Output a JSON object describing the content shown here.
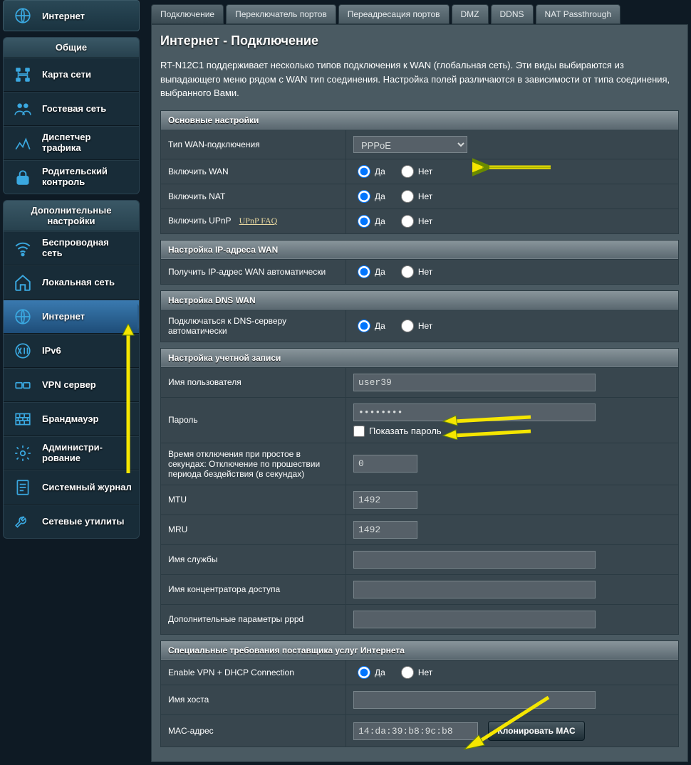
{
  "topItem": "Интернет",
  "sidebar": {
    "general_header": "Общие",
    "general": [
      {
        "label": "Карта сети"
      },
      {
        "label": "Гостевая сеть"
      },
      {
        "label": "Диспетчер трафика"
      },
      {
        "label": "Родительский контроль"
      }
    ],
    "advanced_header": "Дополнительные настройки",
    "advanced": [
      {
        "label": "Беспроводная сеть"
      },
      {
        "label": "Локальная сеть"
      },
      {
        "label": "Интернет",
        "active": true
      },
      {
        "label": "IPv6"
      },
      {
        "label": "VPN сервер"
      },
      {
        "label": "Брандмауэр"
      },
      {
        "label": "Администри-рование"
      },
      {
        "label": "Системный журнал"
      },
      {
        "label": "Сетевые утилиты"
      }
    ]
  },
  "tabs": [
    "Подключение",
    "Переключатель портов",
    "Переадресация портов",
    "DMZ",
    "DDNS",
    "NAT Passthrough"
  ],
  "page": {
    "title": "Интернет - Подключение",
    "desc": "RT-N12C1 поддерживает несколько типов подключения к WAN (глобальная сеть). Эти виды выбираются из выпадающего меню рядом с WAN тип соединения. Настройка полей различаются в зависимости от типа соединения, выбранного Вами."
  },
  "radio": {
    "yes": "Да",
    "no": "Нет"
  },
  "sections": {
    "basic": {
      "header": "Основные настройки",
      "wan_type_label": "Тип WAN-подключения",
      "wan_type": "PPPoE",
      "enable_wan_label": "Включить WAN",
      "enable_nat_label": "Включить NAT",
      "enable_upnp_label": "Включить UPnP",
      "upnp_faq": "UPnP FAQ"
    },
    "ipwan": {
      "header": "Настройка IP-адреса WAN",
      "auto_label": "Получить IP-адрес WAN автоматически"
    },
    "dnswan": {
      "header": "Настройка DNS WAN",
      "auto_label": "Подключаться к DNS-серверу автоматически"
    },
    "account": {
      "header": "Настройка учетной записи",
      "user_label": "Имя пользователя",
      "user": "user39",
      "pass_label": "Пароль",
      "pass": "••••••••",
      "show_pass": "Показать пароль",
      "idle_label": "Время отключения при простое в секундах: Отключение по прошествии периода бездействия (в секундах)",
      "idle": "0",
      "mtu_label": "MTU",
      "mtu": "1492",
      "mru_label": "MRU",
      "mru": "1492",
      "service_label": "Имя службы",
      "concentrator_label": "Имя концентратора доступа",
      "pppd_label": "Дополнительные параметры pppd"
    },
    "isp": {
      "header": "Специальные требования поставщика услуг Интернета",
      "vpn_dhcp_label": "Enable VPN + DHCP Connection",
      "hostname_label": "Имя хоста",
      "mac_label": "MAC-адрес",
      "mac": "14:da:39:b8:9c:b8",
      "clone_btn": "Клонировать MAC"
    }
  }
}
